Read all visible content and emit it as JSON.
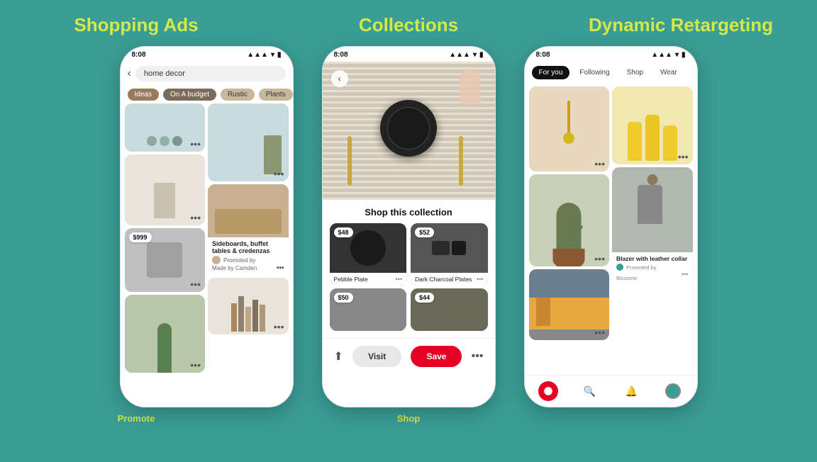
{
  "sections": [
    {
      "id": "shopping-ads",
      "title": "Shopping Ads",
      "bottom_label": "Promote"
    },
    {
      "id": "collections",
      "title": "Collections",
      "bottom_label": "Shop"
    },
    {
      "id": "dynamic-retargeting",
      "title": "Dynamic\nRetargeting",
      "bottom_label": ""
    }
  ],
  "phone1": {
    "status_time": "8:08",
    "search_text": "home decor",
    "chips": [
      "Ideas",
      "On A budget",
      "Rustic",
      "Plants"
    ],
    "pin_price": "$999",
    "promo_title": "Sideboards, buffet tables & credenzas",
    "promoted_by": "Promoted by",
    "maker": "Made by Camden"
  },
  "phone2": {
    "status_time": "8:08",
    "shop_collection_title": "Shop this collection",
    "products": [
      {
        "name": "Pebble Plate",
        "price": "$48"
      },
      {
        "name": "Dark Charcoal Plates",
        "price": "$52"
      },
      {
        "name": "",
        "price": "$50"
      },
      {
        "name": "",
        "price": "$44"
      }
    ],
    "visit_label": "Visit",
    "save_label": "Save"
  },
  "phone3": {
    "status_time": "8:08",
    "tabs": [
      "For you",
      "Following",
      "Shop",
      "Wear"
    ],
    "active_tab": "For you",
    "promo_title": "Blazer with leather collar",
    "promoted_by": "Promoted by",
    "brand": "Bluxome"
  }
}
